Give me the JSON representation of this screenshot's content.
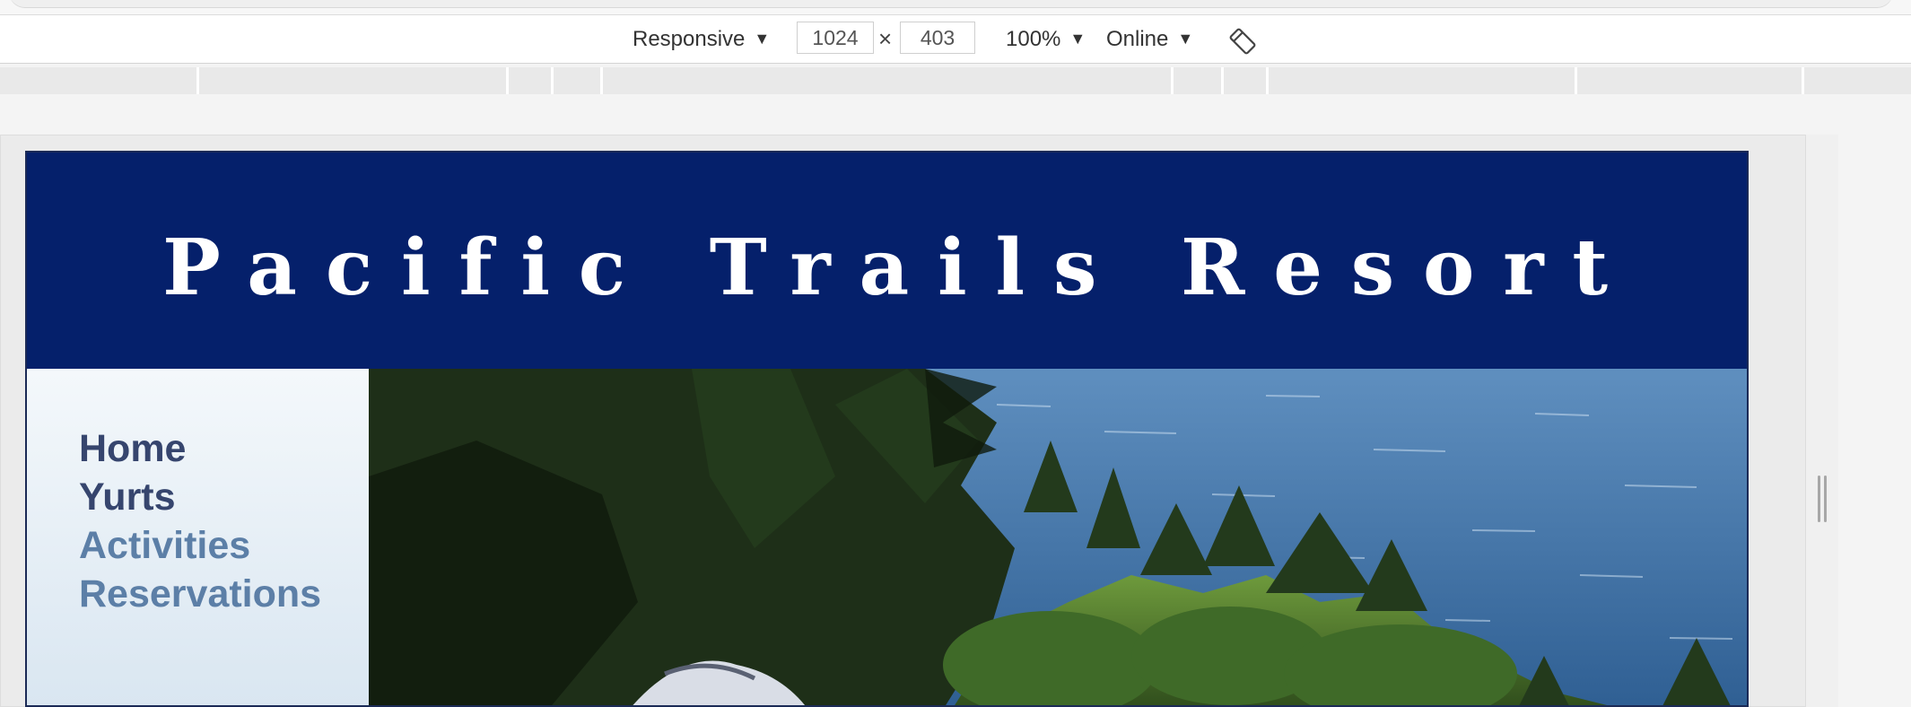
{
  "devtools": {
    "device_mode": "Responsive",
    "width": "1024",
    "height": "403",
    "times": "×",
    "zoom": "100%",
    "network": "Online"
  },
  "site": {
    "title": "Pacific Trails Resort",
    "colors": {
      "header_bg": "#05206b",
      "nav_visited": "#36456e",
      "nav_link": "#5c7fa7"
    },
    "nav": [
      {
        "label": "Home",
        "state": "visited"
      },
      {
        "label": "Yurts",
        "state": "visited"
      },
      {
        "label": "Activities",
        "state": "link"
      },
      {
        "label": "Reservations",
        "state": "link"
      }
    ],
    "hero_image": "coastal-yurt-photo"
  }
}
